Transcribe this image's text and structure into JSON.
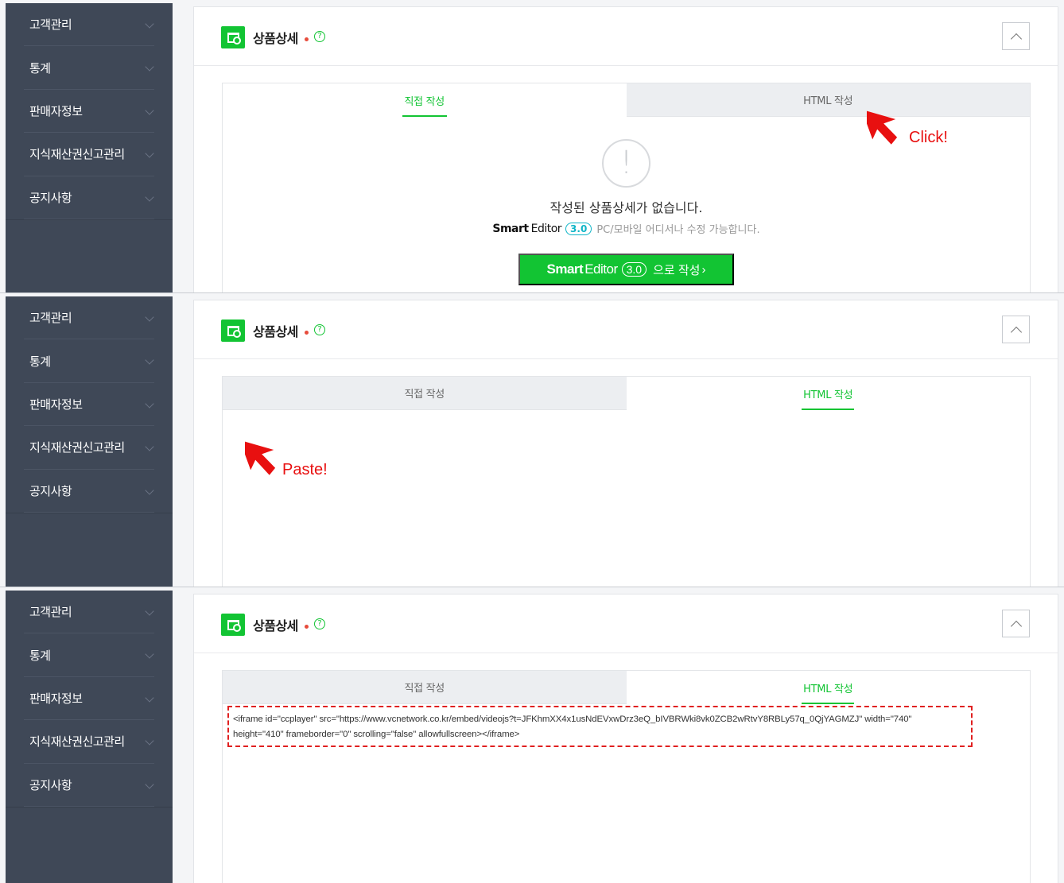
{
  "sidebar": {
    "items": [
      {
        "label": "고객관리"
      },
      {
        "label": "통계"
      },
      {
        "label": "판매자정보"
      },
      {
        "label": "지식재산권신고관리"
      },
      {
        "label": "공지사항"
      }
    ]
  },
  "section": {
    "title": "상품상세",
    "help_glyph": "?"
  },
  "tabs": {
    "direct": "직접 작성",
    "html": "HTML 작성"
  },
  "empty_state": {
    "icon_glyph": "!",
    "message": "작성된 상품상세가 없습니다.",
    "brand_smart": "Smart",
    "brand_editor": "Editor",
    "brand_version": "3.0",
    "sub_text": "PC/모바일 어디서나 수정 가능합니다.",
    "button_suffix": "으로 작성",
    "button_arrow": "›"
  },
  "html_code": {
    "line1": "<iframe id=\"ccplayer\" src=\"https://www.vcnetwork.co.kr/embed/videojs?t=JFKhmXX4x1usNdEVxwDrz3eQ_bIVBRWki8vk0ZCB2wRtvY8RBLy57q_0QjYAGMZJ\" width=\"740\"",
    "line2": "height=\"410\" frameborder=\"0\" scrolling=\"false\" allowfullscreen></iframe>"
  },
  "annotations": {
    "click": "Click!",
    "paste": "Paste!"
  },
  "colors": {
    "accent_green": "#12c433",
    "sidebar_bg": "#3f4857",
    "annotation_red": "#e81010"
  },
  "icons": {
    "section": "product-detail-icon",
    "help": "help-circle-icon",
    "collapse": "chevron-up-icon",
    "sidebar_expand": "chevron-down-icon",
    "empty": "exclamation-circle-icon",
    "pointer": "red-arrow-cursor-icon"
  }
}
